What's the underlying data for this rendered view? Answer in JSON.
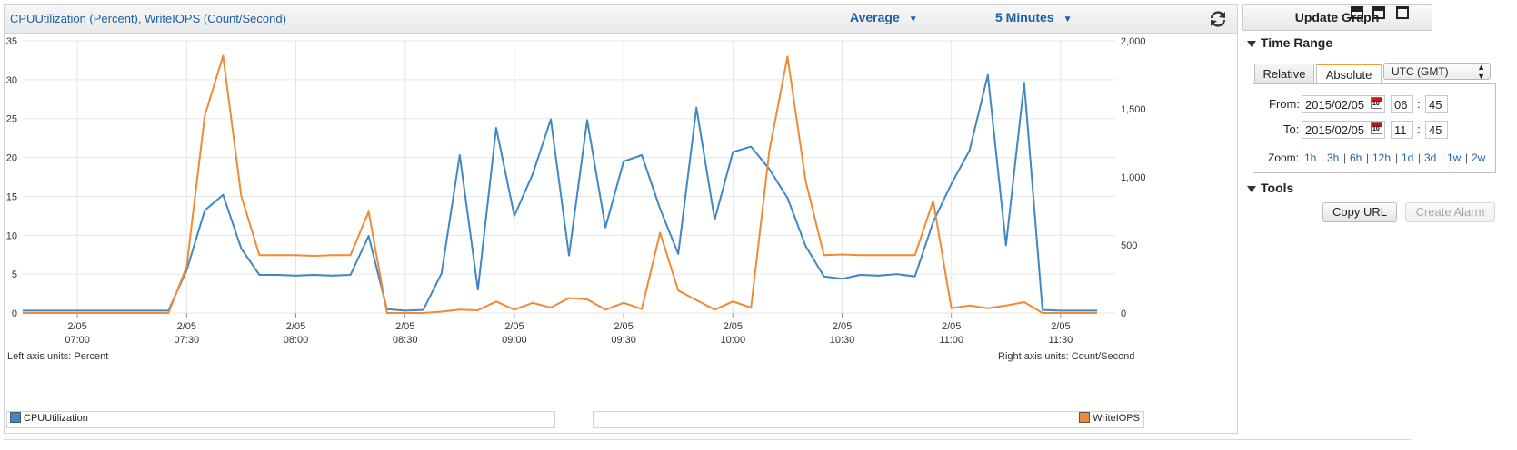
{
  "graph": {
    "title": "CPUUtilization (Percent), WriteIOPS (Count/Second)",
    "statistic": "Average",
    "period": "5 Minutes",
    "left_axis_note": "Left axis units: Percent",
    "right_axis_note": "Right axis units: Count/Second"
  },
  "legend": {
    "left": {
      "label": "CPUUtilization",
      "color": "#3f88c5"
    },
    "right": {
      "label": "WriteIOPS",
      "color": "#f08a33"
    }
  },
  "sidebar": {
    "update_button": "Update Graph",
    "layout_icons": [
      "single-graph-icon",
      "double-graph-icon",
      "full-graph-icon"
    ],
    "time_range": {
      "title": "Time Range",
      "tabs": [
        "Relative",
        "Absolute"
      ],
      "active_tab": "Absolute",
      "timezone": "UTC (GMT)",
      "from_label": "From:",
      "from_date": "2015/02/05",
      "from_hour": "06",
      "from_minute": "45",
      "to_label": "To:",
      "to_date": "2015/02/05",
      "to_hour": "11",
      "to_minute": "45",
      "calendar_day": "10",
      "time_sep": ":",
      "zoom_label": "Zoom:",
      "zoom_options": [
        "1h",
        "3h",
        "6h",
        "12h",
        "1d",
        "3d",
        "1w",
        "2w"
      ]
    },
    "tools": {
      "title": "Tools",
      "copy_url": "Copy URL",
      "create_alarm": "Create Alarm"
    }
  },
  "chart_data": {
    "type": "line",
    "left_axis": {
      "ticks": [
        0,
        5,
        10,
        15,
        20,
        25,
        30,
        35
      ],
      "ylim": [
        0,
        35
      ]
    },
    "right_axis": {
      "ticks": [
        "0",
        "500",
        "1,000",
        "1,500",
        "2,000"
      ],
      "tick_values": [
        0,
        500,
        1000,
        1500,
        2000
      ],
      "ylim": [
        0,
        2000
      ]
    },
    "x_ticks": [
      {
        "date": "2/05",
        "time": "07:00",
        "minutes": 420
      },
      {
        "date": "2/05",
        "time": "07:30",
        "minutes": 450
      },
      {
        "date": "2/05",
        "time": "08:00",
        "minutes": 480
      },
      {
        "date": "2/05",
        "time": "08:30",
        "minutes": 510
      },
      {
        "date": "2/05",
        "time": "09:00",
        "minutes": 540
      },
      {
        "date": "2/05",
        "time": "09:30",
        "minutes": 570
      },
      {
        "date": "2/05",
        "time": "10:00",
        "minutes": 600
      },
      {
        "date": "2/05",
        "time": "10:30",
        "minutes": 630
      },
      {
        "date": "2/05",
        "time": "11:00",
        "minutes": 660
      },
      {
        "date": "2/05",
        "time": "11:30",
        "minutes": 690
      }
    ],
    "x_range_minutes": [
      405,
      705
    ],
    "x_minutes": [
      405,
      410,
      415,
      420,
      425,
      430,
      435,
      440,
      445,
      450,
      455,
      460,
      465,
      470,
      475,
      480,
      485,
      490,
      495,
      500,
      505,
      510,
      515,
      520,
      525,
      530,
      535,
      540,
      545,
      550,
      555,
      560,
      565,
      570,
      575,
      580,
      585,
      590,
      595,
      600,
      605,
      610,
      615,
      620,
      625,
      630,
      635,
      640,
      645,
      650,
      655,
      660,
      665,
      670,
      675,
      680,
      685,
      690,
      695,
      700
    ],
    "series": [
      {
        "name": "CPUUtilization",
        "axis": "left",
        "color": "#3f88c5",
        "values": [
          0.3,
          0.3,
          0.3,
          0.3,
          0.3,
          0.3,
          0.3,
          0.3,
          0.3,
          5.5,
          13.2,
          15.2,
          8.3,
          4.9,
          4.9,
          4.8,
          4.9,
          4.8,
          4.9,
          9.9,
          0.5,
          0.3,
          0.4,
          5.1,
          20.3,
          3.0,
          23.8,
          12.5,
          17.8,
          24.9,
          7.4,
          24.8,
          11.0,
          19.5,
          20.3,
          13.4,
          7.6,
          26.4,
          12.0,
          20.7,
          21.4,
          18.5,
          14.8,
          8.6,
          4.7,
          4.4,
          4.9,
          4.8,
          5.0,
          4.7,
          11.7,
          16.6,
          20.9,
          30.6,
          8.7,
          29.6,
          0.4,
          0.3,
          0.3,
          0.3
        ]
      },
      {
        "name": "WriteIOPS",
        "axis": "right",
        "color": "#f08a33",
        "values": [
          0,
          0,
          0,
          0,
          0,
          0,
          0,
          0,
          0,
          340,
          1450,
          1890,
          860,
          425,
          425,
          425,
          420,
          425,
          425,
          745,
          0,
          0,
          0,
          10,
          25,
          20,
          85,
          25,
          75,
          40,
          110,
          100,
          25,
          75,
          30,
          590,
          165,
          95,
          25,
          85,
          40,
          1190,
          1885,
          970,
          425,
          430,
          425,
          425,
          425,
          425,
          825,
          35,
          55,
          35,
          55,
          80,
          0,
          0,
          0,
          0
        ]
      }
    ]
  }
}
